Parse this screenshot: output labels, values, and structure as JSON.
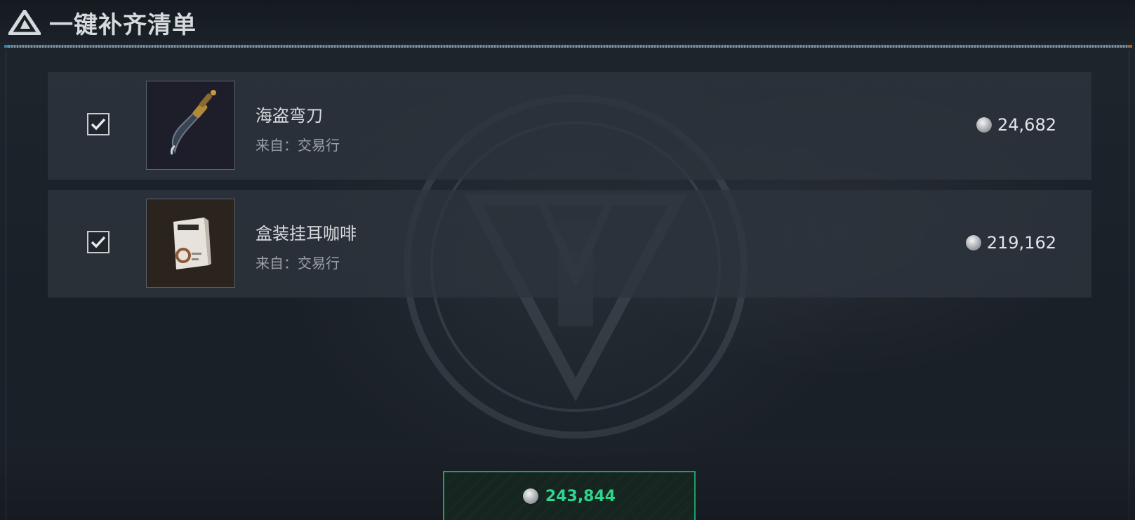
{
  "window": {
    "title": "一键补齐清单"
  },
  "items": [
    {
      "name": "海盗弯刀",
      "source": "来自：交易行",
      "price": "24,682",
      "checked": true,
      "icon": "pirate-scimitar-image"
    },
    {
      "name": "盒装挂耳咖啡",
      "source": "来自：交易行",
      "price": "219,162",
      "checked": true,
      "icon": "boxed-drip-coffee-image"
    }
  ],
  "total": {
    "value": "243,844",
    "color": "#2dd68e"
  },
  "colors": {
    "accent_green": "#1f9e69",
    "background": "#1b2128",
    "row_background": "#2e353e"
  },
  "icons": {
    "currency": "silver-coin-icon",
    "logo": "triangle-logo-icon",
    "checkbox": "checkmark-icon"
  }
}
